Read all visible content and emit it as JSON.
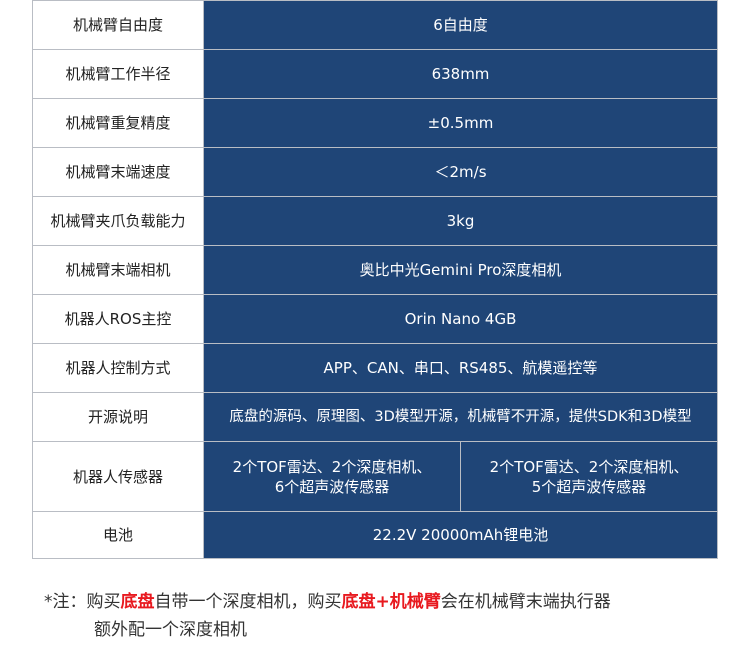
{
  "specs": [
    {
      "label": "机械臂自由度",
      "value": "6自由度"
    },
    {
      "label": "机械臂工作半径",
      "value": "638mm"
    },
    {
      "label": "机械臂重复精度",
      "value": "±0.5mm"
    },
    {
      "label": "机械臂末端速度",
      "value": "＜2m/s"
    },
    {
      "label": "机械臂夹爪负载能力",
      "value": "3kg"
    },
    {
      "label": "机械臂末端相机",
      "value": "奥比中光Gemini Pro深度相机"
    },
    {
      "label": "机器人ROS主控",
      "value": "Orin Nano 4GB"
    },
    {
      "label": "机器人控制方式",
      "value": "APP、CAN、串口、RS485、航模遥控等"
    },
    {
      "label": "开源说明",
      "value": "底盘的源码、原理图、3D模型开源，机械臂不开源，提供SDK和3D模型"
    }
  ],
  "sensors": {
    "label": "机器人传感器",
    "left_line1": "2个TOF雷达、2个深度相机、",
    "left_line2": "6个超声波传感器",
    "right_line1": "2个TOF雷达、2个深度相机、",
    "right_line2": "5个超声波传感器"
  },
  "battery": {
    "label": "电池",
    "value": "22.2V 20000mAh锂电池"
  },
  "note": {
    "prefix": "*注：购买",
    "highlight1": "底盘",
    "mid": "自带一个深度相机，购买",
    "highlight2": "底盘+机械臂",
    "suffix": "会在机械臂末端执行器",
    "line2": "额外配一个深度相机"
  },
  "colors": {
    "value_bg": "#1f4577",
    "highlight": "#e8191f",
    "border": "#b9bdc4"
  }
}
